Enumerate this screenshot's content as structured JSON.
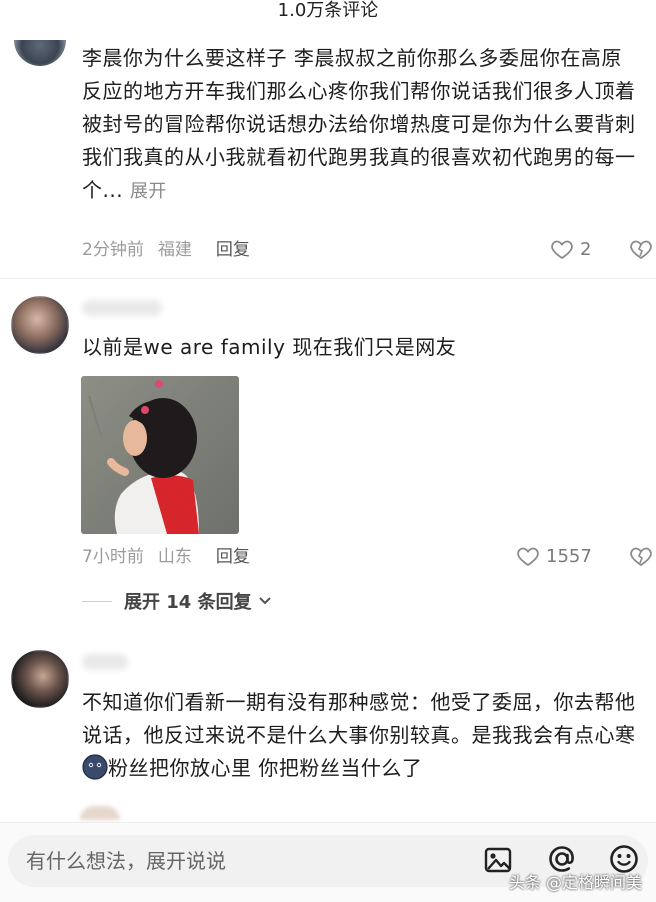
{
  "header": {
    "title": "1.0万条评论"
  },
  "comments": [
    {
      "text": "李晨你为什么要这样子 李晨叔叔之前你那么多委屈你在高原反应的地方开车我们那么心疼你我们帮你说话我们很多人顶着被封号的冒险帮你说话想办法给你增热度可是你为什么要背刺我们我真的从小我就看初代跑男我真的很喜欢初代跑男的每一个...",
      "expand_label": "展开",
      "time": "2分钟前",
      "location": "福建",
      "reply_label": "回复",
      "likes": "2"
    },
    {
      "text": "以前是we are family 现在我们只是网友",
      "time": "7小时前",
      "location": "山东",
      "reply_label": "回复",
      "likes": "1557",
      "expand_replies_label": "展开 14 条回复"
    },
    {
      "text": "不知道你们看新一期有没有那种感觉：他受了委屈，你去帮他说话，他反过来说不是什么大事你别较真。是我我会有点心寒",
      "text_after_emoji": "粉丝把你放心里 你把粉丝当什么了"
    }
  ],
  "input_bar": {
    "placeholder": "有什么想法，展开说说"
  },
  "watermark": "头条 @定格瞬间美",
  "icons": [
    "heart-icon",
    "dislike-icon",
    "image-icon",
    "at-icon",
    "emoji-icon",
    "chevron-down-icon"
  ]
}
